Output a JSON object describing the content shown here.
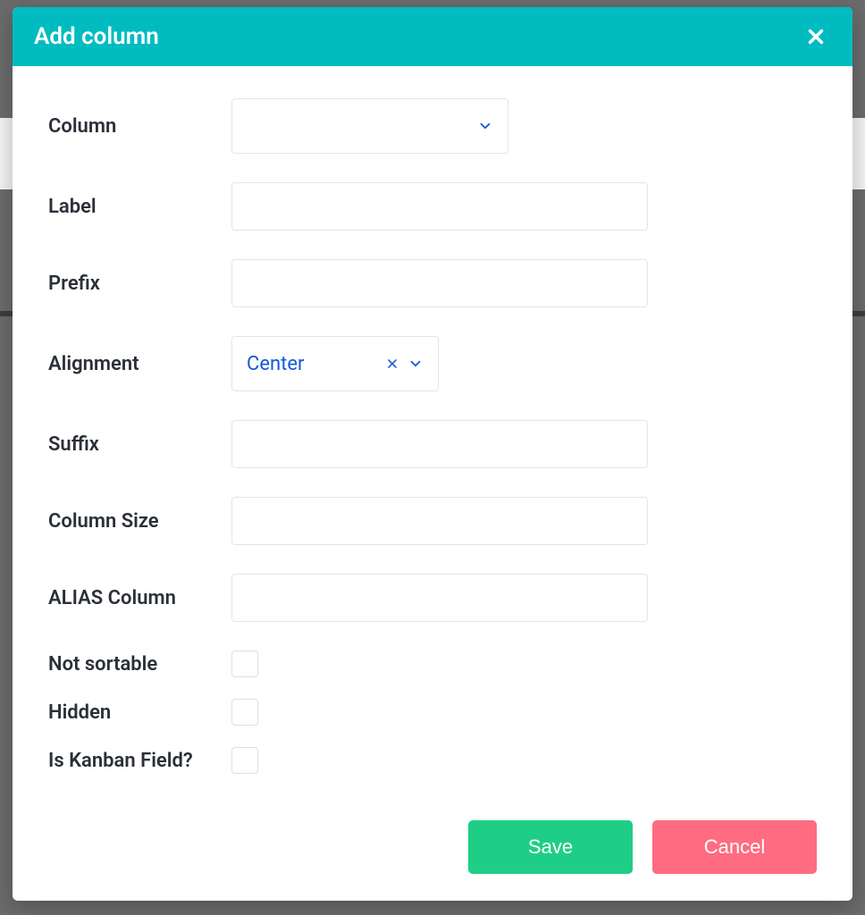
{
  "modal": {
    "title": "Add column"
  },
  "fields": {
    "column": {
      "label": "Column",
      "value": ""
    },
    "label": {
      "label": "Label",
      "value": ""
    },
    "prefix": {
      "label": "Prefix",
      "value": ""
    },
    "alignment": {
      "label": "Alignment",
      "value": "Center"
    },
    "suffix": {
      "label": "Suffix",
      "value": ""
    },
    "columnSize": {
      "label": "Column Size",
      "value": ""
    },
    "aliasColumn": {
      "label": "ALIAS Column",
      "value": ""
    },
    "notSortable": {
      "label": "Not sortable",
      "checked": false
    },
    "hidden": {
      "label": "Hidden",
      "checked": false
    },
    "isKanban": {
      "label": "Is Kanban Field?",
      "checked": false
    }
  },
  "buttons": {
    "save": "Save",
    "cancel": "Cancel"
  }
}
